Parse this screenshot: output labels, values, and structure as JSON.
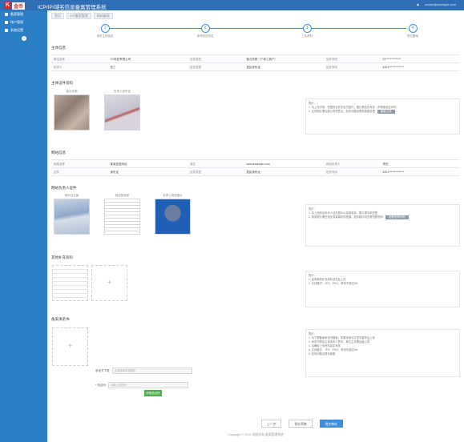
{
  "header": {
    "logo_letter": "K",
    "logo_brand": "金币",
    "title": "ICP/IP/域名信息备案管理系统",
    "user": "admin@example.com"
  },
  "sidebar": {
    "items": [
      {
        "label": "备案管理"
      },
      {
        "label": "账户管理"
      },
      {
        "label": "系统设置"
      }
    ]
  },
  "breadcrumb": {
    "items": [
      "首页",
      "ICP备案管理",
      "网站备案"
    ]
  },
  "steps": [
    {
      "num": "1",
      "label": "填写主体信息"
    },
    {
      "num": "2",
      "label": "填写网站信息"
    },
    {
      "num": "3",
      "label": "上传资料"
    },
    {
      "num": "4",
      "label": "提交备案"
    }
  ],
  "sections": {
    "subject_info": "主体信息",
    "subject_docs": "主体证件资料",
    "site_info": "网站信息",
    "site_docs": "网站负责人证件",
    "other_docs": "其他补充资料",
    "commitment": "备案承诺书"
  },
  "subject_table": {
    "rows": [
      [
        "单位名称",
        "XX科技有限公司",
        "证件类型",
        "营业执照（个体工商户）",
        "证件号码",
        "91**************"
      ],
      [
        "负责人",
        "张三",
        "证件类型",
        "居民身份证",
        "证件号码",
        "4401**************"
      ]
    ]
  },
  "subject_photos": [
    {
      "caption": "营业执照"
    },
    {
      "caption": "负责人身份证"
    }
  ],
  "subject_tip": {
    "title": "提示：",
    "line1": "1. 请上传清晰、完整的证件彩色扫描件，照片需真实有效（不得使用复印件）",
    "line2": "2. 证件照片需加盖公章或签名，如有问题请联系客服处理",
    "button": "重新上传"
  },
  "site_table": {
    "rows": [
      [
        "网站名称",
        "某某信息网站",
        "域名",
        "www.example.com",
        "网站负责人",
        "李四"
      ],
      [
        "证件",
        "身份证",
        "证件类型",
        "居民身份证",
        "证件号码",
        "4401**************"
      ]
    ]
  },
  "site_photos": [
    {
      "caption": "身份证正面"
    },
    {
      "caption": "网站核验单"
    },
    {
      "caption": "负责人核验照片"
    }
  ],
  "site_tip": {
    "title": "提示：",
    "line1": "1. 请上传网站负责人证件照片以及核验单，照片需清晰完整",
    "line2": "2. 核验照片需在指定背景幕布前拍摄，如有疑问请查看拍照说明",
    "button": "查看拍照示例"
  },
  "other_tip": {
    "title": "提示：",
    "line1": "1. 如有其他补充资料请在此上传",
    "line2": "2. 支持格式：JPG、PNG，单张不超过5M"
  },
  "commit_tip": {
    "title": "提示：",
    "line1": "1. 请下载备案承诺书模板，按要求填写并签字盖章后上传",
    "line2": "2. 承诺书需由主体负责人签字，单位主体需加盖公章",
    "line3": "3. 请确保上传资料真实有效",
    "line4": "4. 支持格式：JPG、PNG，单张不超过5M",
    "line5": "5. 如有问题请联系客服"
  },
  "form": {
    "label1": "承诺书下载",
    "placeholder1": "请选择承诺书模板",
    "label2": "* 验证码",
    "placeholder2": "请输入验证码",
    "green_button": "获取验证码"
  },
  "buttons": {
    "prev": "上一步",
    "save": "保存草稿",
    "submit": "提交审核"
  },
  "footer": "Copyright © 2020 版权所有 备案管理系统"
}
